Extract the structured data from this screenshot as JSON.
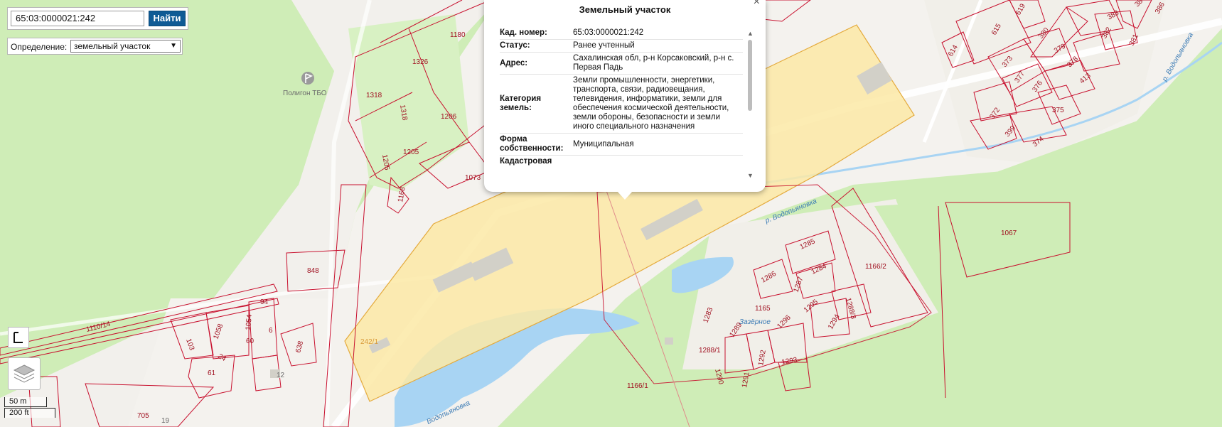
{
  "search": {
    "value": "65:03:0000021:242",
    "button_label": "Найти"
  },
  "definition": {
    "label": "Определение:",
    "selected": "земельный участок"
  },
  "popup": {
    "title": "Земельный участок",
    "close_symbol": "×",
    "rows": [
      {
        "key": "Кад. номер:",
        "value": "65:03:0000021:242"
      },
      {
        "key": "Статус:",
        "value": "Ранее учтенный"
      },
      {
        "key": "Адрес:",
        "value": "Сахалинская обл, р-н Корсаковский, р-н с. Первая Падь"
      },
      {
        "key": "Категория земель:",
        "value": "Земли промышленности, энергетики, транспорта, связи, радиовещания, телевидения, информатики, земли для обеспечения космической деятельности, земли обороны, безопасности и земли иного специального назначения"
      },
      {
        "key": "Форма собственности:",
        "value": "Муниципальная"
      },
      {
        "key": "Кадастровая",
        "value": ""
      }
    ]
  },
  "map_labels": {
    "poi": "Полигон ТБО",
    "river1": "р. Водопьяновка",
    "river2": "р. Водопьяновка",
    "river3": "Водопьяновка",
    "village": "Зазёрное",
    "selected_parcel": "242/1",
    "parcels": [
      "1180",
      "1326",
      "1318",
      "1318",
      "1206",
      "1205",
      "1205",
      "1168",
      "1073",
      "848",
      "94",
      "1054",
      "1058",
      "103",
      "6",
      "60",
      "24",
      "61",
      "638",
      "12",
      "705",
      "19",
      "1110/14",
      "1166/1",
      "1166/2",
      "1067",
      "1165",
      "1288/1",
      "1288/3",
      "1285",
      "1284",
      "1286",
      "1287",
      "1283",
      "1289",
      "1296",
      "1295",
      "1294",
      "1292",
      "1293",
      "1290",
      "1291",
      "615",
      "619",
      "614",
      "373",
      "377",
      "380",
      "379",
      "378",
      "376",
      "372",
      "399",
      "374",
      "375",
      "413",
      "381",
      "382",
      "383",
      "384",
      "386"
    ]
  },
  "scale": {
    "metric": "50 m",
    "imperial": "200 ft"
  },
  "icons": {
    "extent": "extent-icon",
    "layers": "layers-icon",
    "poi": "flag-icon"
  }
}
